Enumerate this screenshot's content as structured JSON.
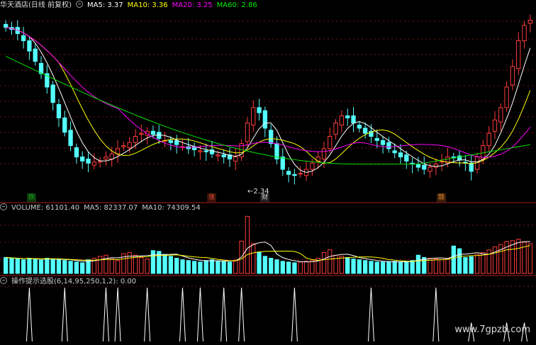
{
  "header_main": {
    "title": "华天酒店(日线 前复权)",
    "ma5": "MA5: 3.37",
    "ma10": "MA10: 3.36",
    "ma20": "MA20: 3.25",
    "ma60": "MA60: 2.86"
  },
  "header_volume": {
    "title": "VOLUME: 61101.40",
    "ma5": "MA5: 82337.07",
    "ma10": "MA10: 74309.54"
  },
  "header_indicator": {
    "title": "操作提示选股(6,14,95,250,1,2)",
    "value": ": 0.00"
  },
  "badges": [
    {
      "text": "跌",
      "color": "#1fa01f",
      "bg": "#0a3a0a"
    },
    {
      "text": "涨",
      "color": "#e0503a",
      "bg": "#3a1008"
    },
    {
      "text": "财",
      "color": "#cccccc",
      "bg": "#222222"
    },
    {
      "text": "赣",
      "color": "#e08030",
      "bg": "#3a2008"
    }
  ],
  "low_annotation": "←2.34",
  "watermark": "www.7gpzb.com",
  "colors": {
    "up": "#ff3c3c",
    "down": "#54ffff",
    "ma5": "#ffffff",
    "ma10": "#ffff00",
    "ma20": "#ff00ff",
    "ma60": "#00e000",
    "grid": "#7a1010",
    "separator": "#aa1e1e",
    "indicator": "#ffffff"
  },
  "chart_data": [
    {
      "type": "candlestick",
      "title": "华天酒店(日线 前复权)",
      "ylim": [
        2.3,
        4.05
      ],
      "close": [
        3.88,
        3.86,
        3.82,
        3.75,
        3.65,
        3.55,
        3.43,
        3.3,
        3.15,
        3.0,
        2.86,
        2.73,
        2.62,
        2.58,
        2.56,
        2.57,
        2.58,
        2.62,
        2.65,
        2.7,
        2.73,
        2.76,
        2.82,
        2.85,
        2.87,
        2.84,
        2.8,
        2.78,
        2.76,
        2.74,
        2.72,
        2.7,
        2.69,
        2.68,
        2.67,
        2.65,
        2.64,
        2.62,
        2.6,
        2.62,
        2.75,
        2.95,
        3.1,
        3.05,
        2.9,
        2.75,
        2.6,
        2.5,
        2.45,
        2.44,
        2.46,
        2.5,
        2.56,
        2.62,
        2.7,
        2.82,
        2.95,
        3.02,
        3.0,
        2.95,
        2.9,
        2.85,
        2.82,
        2.78,
        2.74,
        2.7,
        2.66,
        2.62,
        2.58,
        2.55,
        2.52,
        2.5,
        2.52,
        2.55,
        2.58,
        2.62,
        2.61,
        2.59,
        2.56,
        2.48,
        2.62,
        2.73,
        2.85,
        2.98,
        3.1,
        3.3,
        3.5,
        3.75,
        3.9,
        3.95
      ]
    },
    {
      "type": "bar",
      "title": "VOLUME",
      "values": [
        42,
        40,
        38,
        36,
        40,
        38,
        35,
        40,
        38,
        36,
        34,
        32,
        30,
        28,
        36,
        40,
        45,
        48,
        38,
        34,
        52,
        55,
        48,
        42,
        38,
        60,
        58,
        50,
        45,
        40,
        36,
        34,
        32,
        30,
        34,
        36,
        33,
        31,
        30,
        35,
        85,
        150,
        78,
        55,
        45,
        40,
        36,
        32,
        30,
        28,
        30,
        32,
        34,
        40,
        55,
        62,
        48,
        45,
        42,
        38,
        36,
        34,
        32,
        30,
        30,
        31,
        32,
        30,
        30,
        34,
        48,
        42,
        40,
        38,
        36,
        40,
        72,
        65,
        42,
        44,
        50,
        55,
        62,
        70,
        76,
        84,
        86,
        90,
        82,
        78
      ]
    },
    {
      "type": "line",
      "title": "操作提示选股(6,14,95,250,1,2)",
      "spikes_at": [
        4,
        10,
        17,
        19,
        24,
        30,
        33,
        37,
        40,
        49,
        62,
        73,
        79,
        85,
        88
      ],
      "spike_heights": [
        1,
        1,
        1,
        1,
        1,
        1,
        1,
        1,
        1,
        1,
        1,
        1,
        0.35,
        0.35,
        0.35
      ]
    }
  ]
}
